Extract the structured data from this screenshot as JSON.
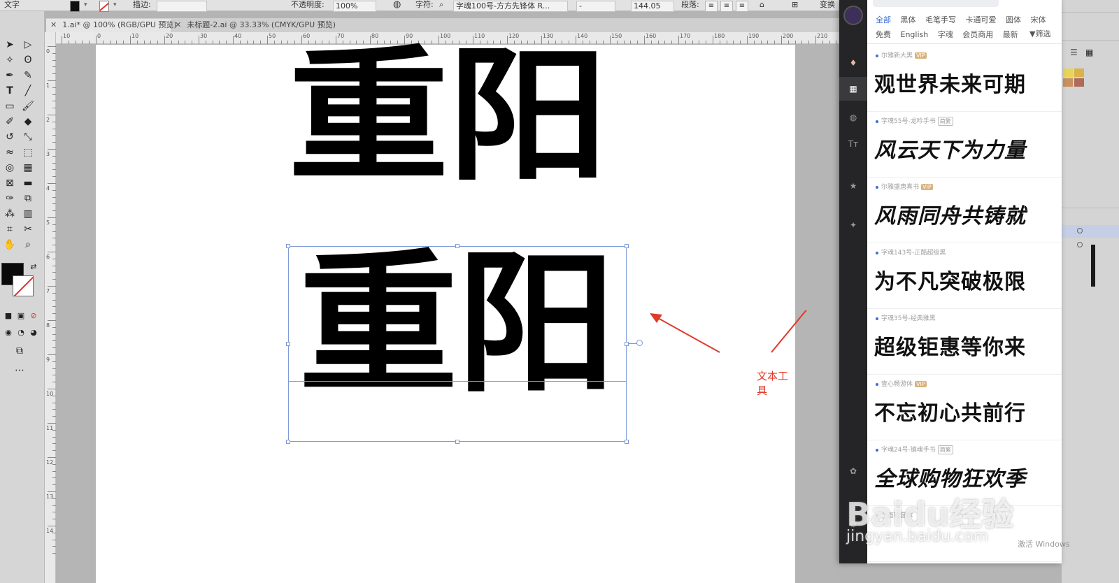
{
  "control_bar": {
    "mode_label": "文字",
    "stroke_label": "描边:",
    "opacity_label": "不透明度:",
    "opacity_value": "100%",
    "char_label": "字符:",
    "font_name": "字魂100号-方方先锋体 R...",
    "font_style": "-",
    "font_size": "144.05",
    "paragraph_label": "段落:",
    "transform_label": "变换"
  },
  "tabs": [
    {
      "label": "1.ai* @ 100% (RGB/GPU 预览)",
      "active": true
    },
    {
      "label": "未标题-2.ai @ 33.33% (CMYK/GPU 预览)",
      "active": false
    }
  ],
  "ruler": {
    "h_labels": [
      "10",
      "0",
      "10",
      "20",
      "30",
      "40",
      "50",
      "60",
      "70",
      "80",
      "90",
      "100",
      "110",
      "120",
      "130",
      "140",
      "150",
      "160",
      "170",
      "180",
      "190",
      "200",
      "210"
    ],
    "v_labels": [
      "0",
      "1",
      "2",
      "3",
      "4",
      "5",
      "6",
      "7",
      "8",
      "9",
      "10",
      "11",
      "12",
      "13",
      "14"
    ]
  },
  "canvas": {
    "text_top": "重阳",
    "text_bottom": "重阳",
    "annotation": "文本工具"
  },
  "plugin": {
    "filters_row1": [
      "全部",
      "黑体",
      "毛笔手写",
      "卡通可爱",
      "圆体",
      "宋体"
    ],
    "filters_row2": [
      "免费",
      "English",
      "字魂",
      "会员商用",
      "最新"
    ],
    "filter_button": "筛选",
    "fonts": [
      {
        "meta": "尔雅新大黑",
        "badge": "VIP",
        "sample": "观世界未来可期"
      },
      {
        "meta": "字魂55号-龙吟手书",
        "badge": "简繁",
        "sample": "风云天下为力量"
      },
      {
        "meta": "尔雅盛唐真书",
        "badge": "VIP",
        "sample": "风雨同舟共铸就"
      },
      {
        "meta": "字魂143号-正酷超级黑",
        "badge": "",
        "sample": "为不凡突破极限"
      },
      {
        "meta": "字魂35号-经典雅黑",
        "badge": "",
        "sample": "超级钜惠等你来"
      },
      {
        "meta": "壹心畅游体",
        "badge": "VIP",
        "sample": "不忘初心共前行"
      },
      {
        "meta": "字魂24号-镇魂手书",
        "badge": "简繁",
        "sample": "全球购物狂欢季"
      },
      {
        "meta": "上首锐圆体",
        "badge": "",
        "sample": ""
      }
    ]
  },
  "watermark": {
    "main": "Baidu经验",
    "sub": "jingyan.baidu.com"
  },
  "windows_notice": "激活 Windows"
}
